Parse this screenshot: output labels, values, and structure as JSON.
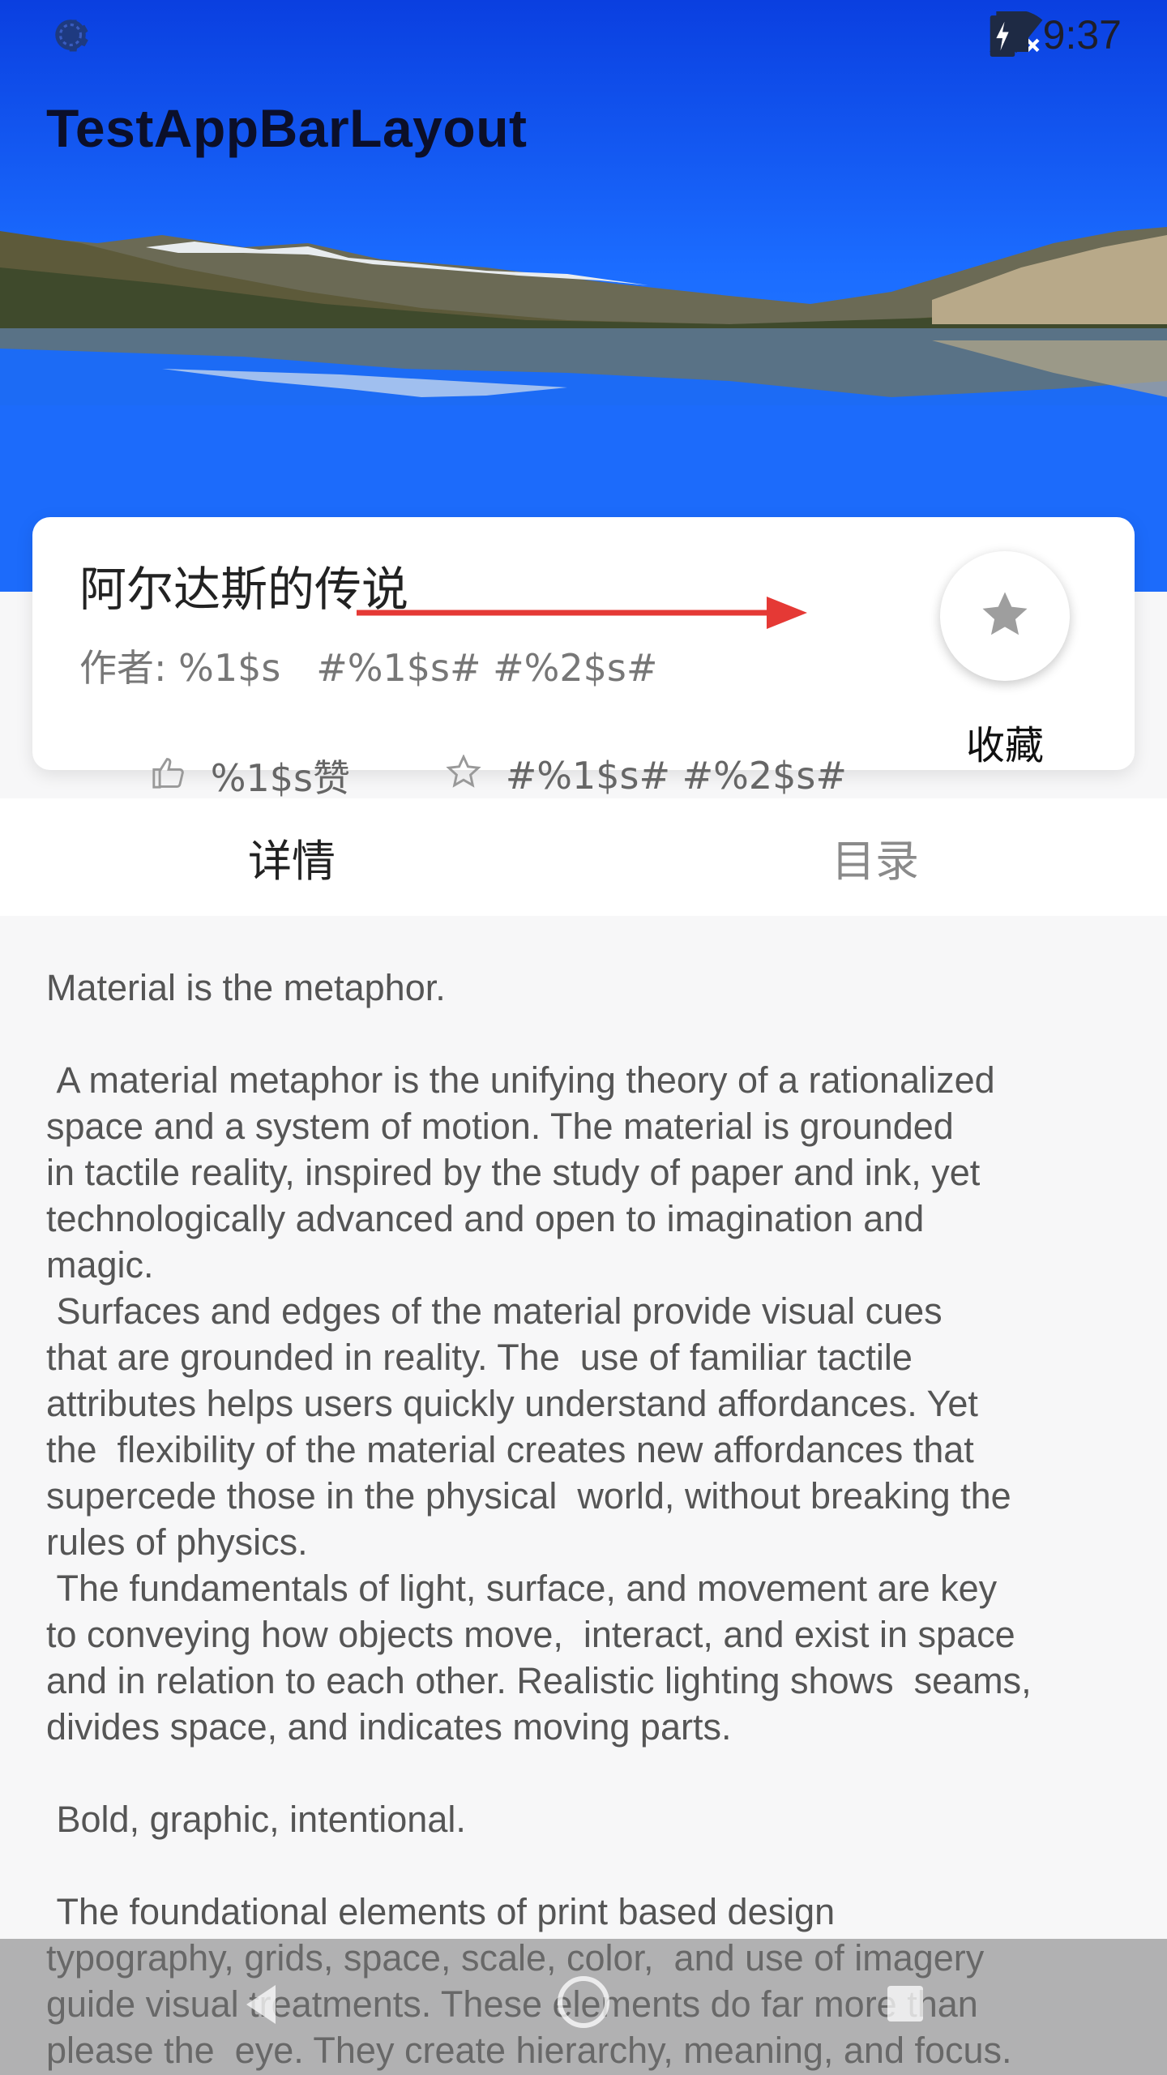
{
  "status_bar": {
    "time": "9:37",
    "icons": [
      "settings-icon",
      "sync-icon",
      "wifi-icon",
      "cell-signal-icon",
      "battery-charging-icon"
    ]
  },
  "app": {
    "title": "TestAppBarLayout"
  },
  "book": {
    "title": "阿尔达斯的传说",
    "author_line": "作者: %1$s   #%1$s# #%2$s#",
    "likes": "%1$s赞",
    "tags": "#%1$s# #%2$s#",
    "favorite_label": "收藏"
  },
  "tabs": [
    {
      "label": "详情",
      "active": true
    },
    {
      "label": "目录",
      "active": false
    }
  ],
  "article": {
    "text": "Material is the metaphor.\n\n A material metaphor is the unifying theory of a rationalized\nspace and a system of motion. The material is grounded\nin tactile reality, inspired by the study of paper and ink, yet\ntechnologically advanced and open to imagination and\nmagic.\n Surfaces and edges of the material provide visual cues\nthat are grounded in reality. The  use of familiar tactile\nattributes helps users quickly understand affordances. Yet\nthe  flexibility of the material creates new affordances that\nsupercede those in the physical  world, without breaking the\nrules of physics.\n The fundamentals of light, surface, and movement are key\nto conveying how objects move,  interact, and exist in space\nand in relation to each other. Realistic lighting shows  seams,\ndivides space, and indicates moving parts.\n\n Bold, graphic, intentional.\n\n The foundational elements of print based design\ntypography, grids, space, scale, color,  and use of imagery\nguide visual treatments. These elements do far more than\nplease the  eye. They create hierarchy, meaning, and focus."
  },
  "colors": {
    "sky_top": "#0a3fe0",
    "accent_red": "#e53935",
    "card_bg": "#ffffff",
    "page_bg": "#f7f7f8"
  }
}
